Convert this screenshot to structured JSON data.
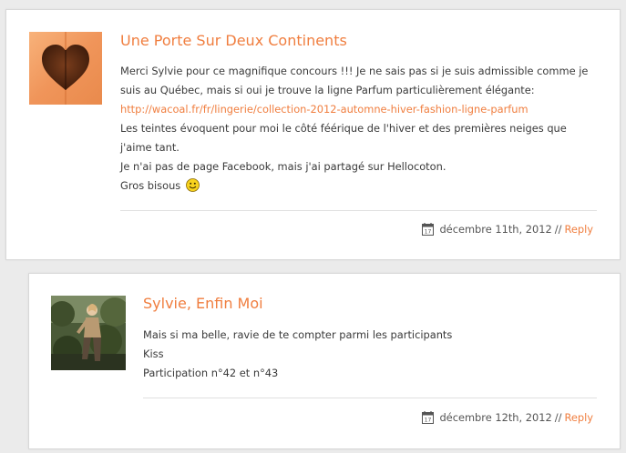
{
  "comments": [
    {
      "author": "Une Porte Sur Deux Continents",
      "lines": [
        "Merci Sylvie pour ce magnifique concours !!! Je ne sais pas si je suis admissible comme je suis au Québec, mais si oui je trouve la ligne Parfum particulièrement élégante:",
        "Les teintes évoquent pour moi le côté féérique de l'hiver et des premières neiges que j'aime tant.",
        "Je n'ai pas de page Facebook, mais j'ai partagé sur Hellocoton.",
        "Gros bisous"
      ],
      "link": "http://wacoal.fr/fr/lingerie/collection-2012-automne-hiver-fashion-ligne-parfum",
      "date": "décembre 11th, 2012",
      "separator": "//",
      "reply": "Reply",
      "avatar_icon": "heart-door-avatar",
      "emoji_icon": "smiley-icon"
    },
    {
      "author": "Sylvie, Enfin Moi",
      "lines": [
        "Mais si ma belle, ravie de te compter parmi les participants",
        "Kiss",
        "Participation n°42 et n°43"
      ],
      "date": "décembre 12th, 2012",
      "separator": "//",
      "reply": "Reply",
      "avatar_icon": "photo-avatar"
    }
  ],
  "colors": {
    "accent": "#f07e3f",
    "text": "#3a3a3a",
    "background": "#ebebeb",
    "card": "#ffffff"
  }
}
